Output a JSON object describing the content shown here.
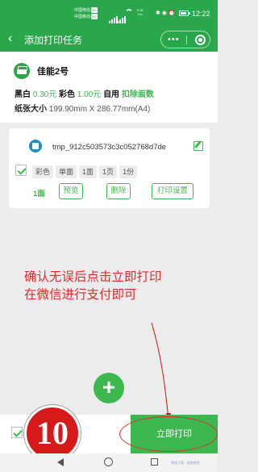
{
  "status_bar": {
    "carrier1": "中国电信",
    "carrier1_badge": "HD",
    "carrier2": "中国移动",
    "carrier2_badge": "HD",
    "net_speed_value": "0.00",
    "net_speed_unit": "K/s",
    "time": "12:22"
  },
  "nav": {
    "back_icon": "chevron-left-icon",
    "title": "添加打印任务",
    "more_icon": "more-dots-icon",
    "close_icon": "target-close-icon"
  },
  "printer": {
    "name": "佳能2号",
    "bw_label": "黑白",
    "bw_price": "0.30元",
    "color_label": "彩色",
    "color_price": "1.00元",
    "self_use": "自用",
    "deduct": "扣除面数",
    "paper_label": "纸张大小",
    "paper_value": "199.90mm X 286.77mm(A4)"
  },
  "file": {
    "name": "tmp_912c503573c3c052768d7de",
    "tags": [
      "彩色",
      "单面",
      "1面",
      "1页",
      "1份"
    ],
    "copies": "1面",
    "preview": "预览",
    "delete": "删除",
    "settings": "打印设置"
  },
  "overlay": {
    "note_line1": "确认无误后点击立即打印",
    "note_line2": "在微信进行支付即可",
    "step_number": "10",
    "accent_color": "#e22b2b"
  },
  "add_button": "+",
  "bottom": {
    "print_now": "立即打印"
  },
  "watermark": "寒城下载 · 极客教程",
  "colors": {
    "brand": "#2aa74a",
    "accent": "#3cb84f"
  }
}
